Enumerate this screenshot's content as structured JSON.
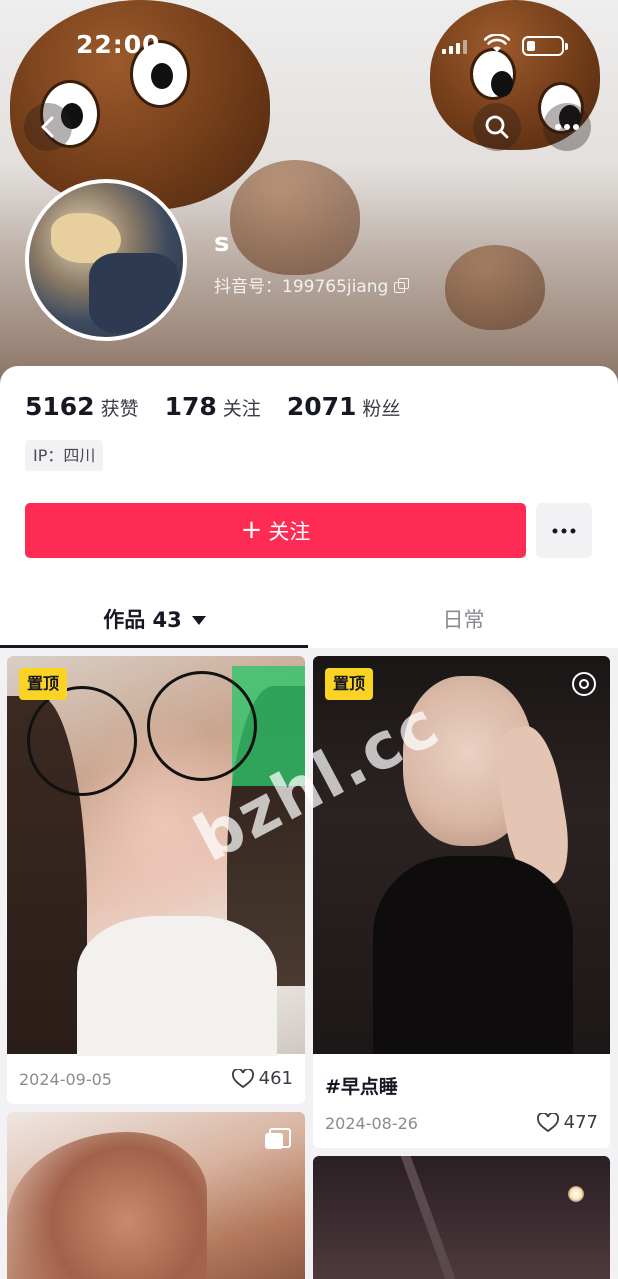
{
  "status_bar": {
    "time": "22:00"
  },
  "profile": {
    "username": "s",
    "douyin_id": "抖音号：199765jiang"
  },
  "stats": [
    {
      "value": "5162",
      "label": "获赞"
    },
    {
      "value": "178",
      "label": "关注"
    },
    {
      "value": "2071",
      "label": "粉丝"
    }
  ],
  "ip": "IP：四川",
  "actions": {
    "follow_label": "关注",
    "follow_symbol": "+"
  },
  "tabs": {
    "works": {
      "label": "作品",
      "count": "43"
    },
    "daily": {
      "label": "日常"
    }
  },
  "posts": [
    {
      "pinned_label": "置顶",
      "date": "2024-09-05",
      "likes": "461"
    },
    {
      "pinned_label": "置顶",
      "caption": "#早点睡",
      "date": "2024-08-26",
      "likes": "477"
    }
  ],
  "watermark": "bzhl.cc",
  "colors": {
    "accent": "#fe2c55",
    "pinned": "#fbd322"
  }
}
